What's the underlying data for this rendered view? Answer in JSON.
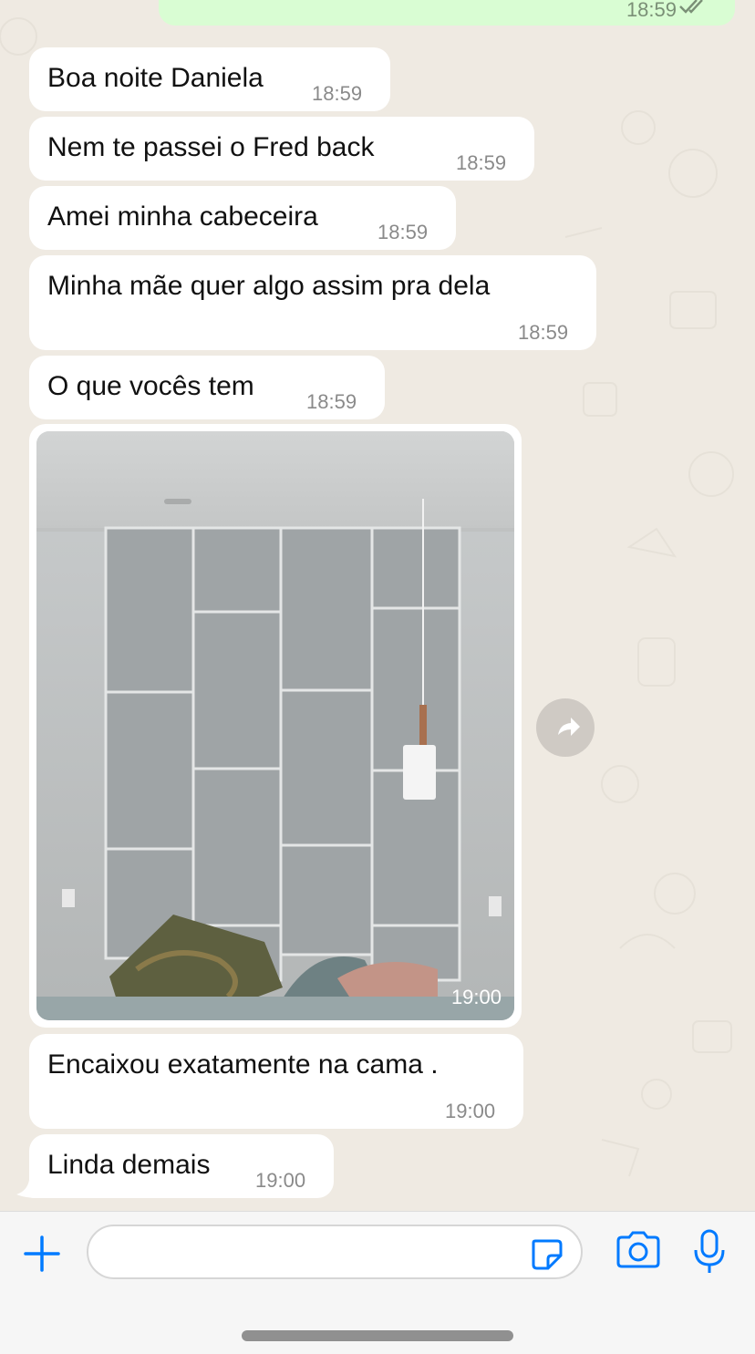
{
  "outgoing": {
    "time": "18:59"
  },
  "messages": [
    {
      "text": "Boa noite Daniela",
      "time": "18:59"
    },
    {
      "text": "Nem te passei o Fred back",
      "time": "18:59"
    },
    {
      "text": "Amei minha cabeceira",
      "time": "18:59"
    },
    {
      "text": "Minha mãe quer algo assim pra dela",
      "time": "18:59"
    },
    {
      "text": "O que vocês tem",
      "time": "18:59"
    },
    {
      "text": "Encaixou exatamente na cama .",
      "time": "19:00"
    },
    {
      "text": "Linda demais",
      "time": "19:00"
    }
  ],
  "photo": {
    "time": "19:00"
  },
  "input": {
    "placeholder": ""
  },
  "icons": {
    "attach": "plus-icon",
    "sticker": "sticker-icon",
    "camera": "camera-icon",
    "mic": "microphone-icon",
    "forward": "forward-icon",
    "read": "double-check-icon"
  },
  "colors": {
    "accent": "#007aff",
    "background": "#efeae2",
    "incoming": "#ffffff",
    "outgoing": "#d9fdd3"
  }
}
